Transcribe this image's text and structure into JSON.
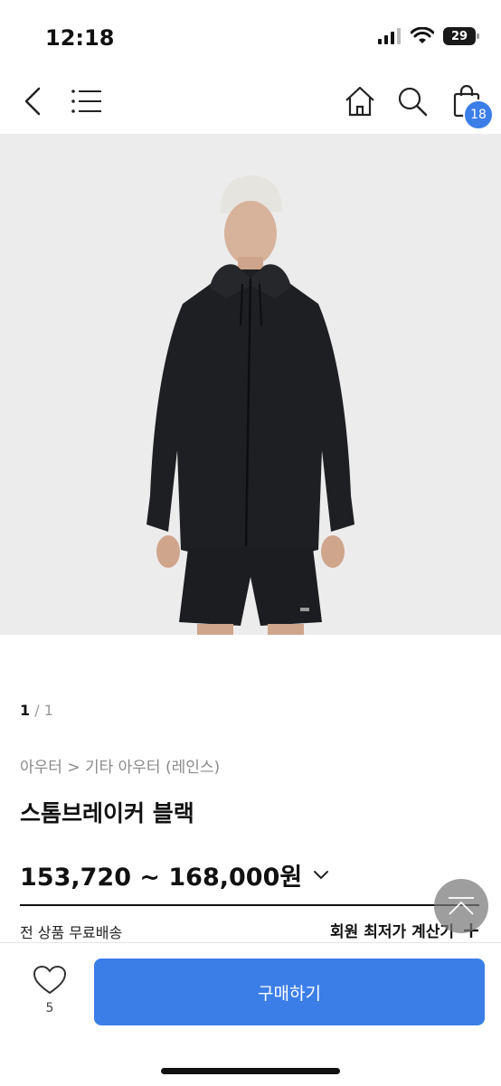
{
  "status_bar": {
    "time": "12:18",
    "battery": "29"
  },
  "nav": {
    "cart_count": "18"
  },
  "gallery": {
    "current": "1",
    "separator": " / ",
    "total": "1"
  },
  "breadcrumb": "아우터 > 기타 아우터 (레인스)",
  "product": {
    "title": "스톰브레이커 블랙",
    "price": "153,720 ~ 168,000원"
  },
  "shipping": "전 상품 무료배송",
  "calculator_label": "회원 최저가 계산기",
  "bottom": {
    "like_count": "5",
    "buy_label": "구매하기"
  },
  "colors": {
    "accent": "#3b7ee8",
    "jacket": "#1e1f22",
    "background": "#ececec"
  }
}
